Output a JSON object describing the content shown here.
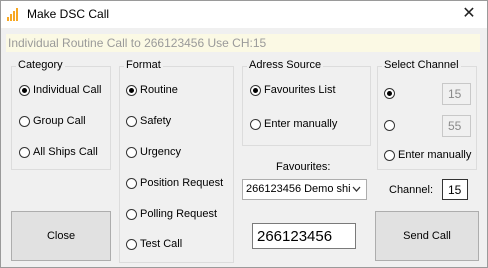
{
  "window": {
    "title": "Make DSC Call",
    "icon": "signal-bars-icon",
    "close_glyph": "✕"
  },
  "status_text": "Individual Routine Call to 266123456 Use CH:15",
  "category": {
    "legend": "Category",
    "options": [
      "Individual Call",
      "Group Call",
      "All Ships Call"
    ],
    "selected": "Individual Call"
  },
  "format": {
    "legend": "Format",
    "options": [
      "Routine",
      "Safety",
      "Urgency",
      "Position Request",
      "Polling Request",
      "Test Call"
    ],
    "selected": "Routine"
  },
  "address_source": {
    "legend": "Adress Source",
    "options": [
      "Favourites List",
      "Enter manually"
    ],
    "selected": "Favourites List"
  },
  "favourites": {
    "label": "Favourites:",
    "selected": "266123456 Demo shi"
  },
  "mmsi_value": "266123456",
  "select_channel": {
    "legend": "Select Channel",
    "channel_a": "15",
    "channel_b": "55",
    "manual_label": "Enter manually",
    "selected": "channel_a"
  },
  "channel": {
    "label": "Channel:",
    "value": "15"
  },
  "buttons": {
    "close": "Close",
    "send": "Send Call"
  }
}
